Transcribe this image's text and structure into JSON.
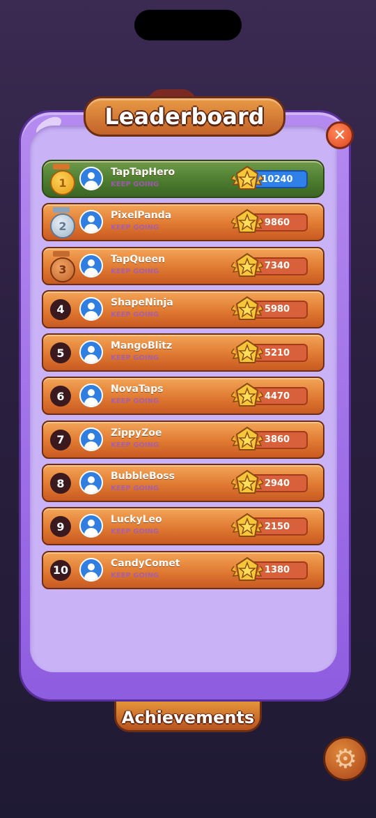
{
  "title": "Leaderboard",
  "achievements_label": "Achievements",
  "players": [
    {
      "rank": "1",
      "name": "TapTapHero",
      "subtitle": "KEEP GOING",
      "score": "10240",
      "medal": "gold"
    },
    {
      "rank": "2",
      "name": "PixelPanda",
      "subtitle": "KEEP GOING",
      "score": "9860",
      "medal": "silver"
    },
    {
      "rank": "3",
      "name": "TapQueen",
      "subtitle": "KEEP GOING",
      "score": "7340",
      "medal": "bronze"
    },
    {
      "rank": "4",
      "name": "ShapeNinja",
      "subtitle": "KEEP GOING",
      "score": "5980"
    },
    {
      "rank": "5",
      "name": "MangoBlitz",
      "subtitle": "KEEP GOING",
      "score": "5210"
    },
    {
      "rank": "6",
      "name": "NovaTaps",
      "subtitle": "KEEP GOING",
      "score": "4470"
    },
    {
      "rank": "7",
      "name": "ZippyZoe",
      "subtitle": "KEEP GOING",
      "score": "3860"
    },
    {
      "rank": "8",
      "name": "BubbleBoss",
      "subtitle": "KEEP GOING",
      "score": "2940"
    },
    {
      "rank": "9",
      "name": "LuckyLeo",
      "subtitle": "KEEP GOING",
      "score": "2150"
    },
    {
      "rank": "10",
      "name": "CandyComet",
      "subtitle": "KEEP GOING",
      "score": "1380"
    }
  ],
  "icons": {
    "close": "close-icon",
    "settings": "gear-icon",
    "score": "star-badge-icon",
    "avatar": "user-avatar-icon"
  },
  "colors": {
    "panel": "#9b6ae6",
    "panel_inner": "#c9b2f6",
    "row": "#e07a32",
    "row_first": "#4a7a2e",
    "score_first": "#2f80e8"
  }
}
